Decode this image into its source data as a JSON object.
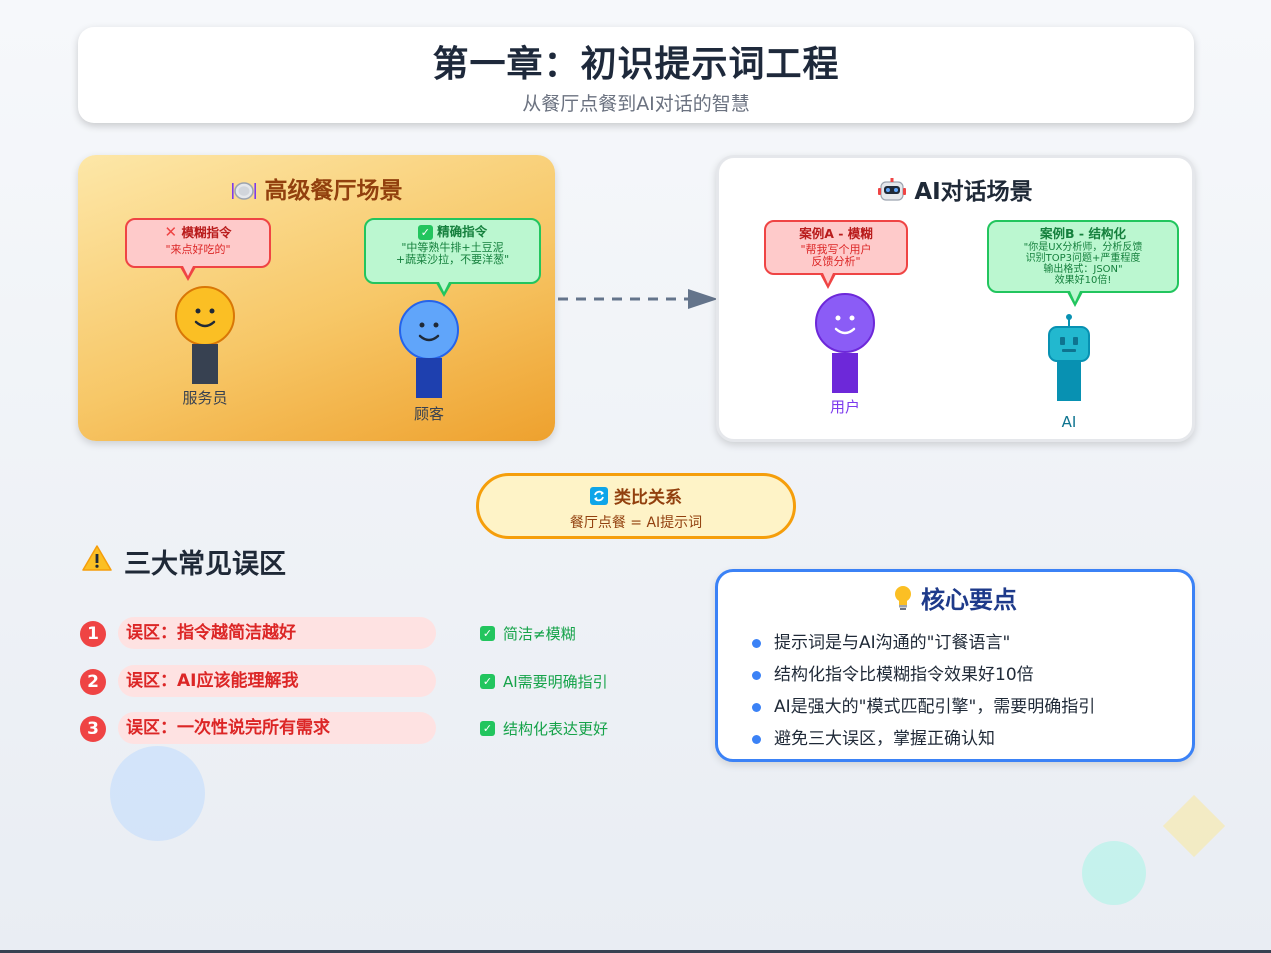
{
  "header": {
    "title": "第一章：初识提示词工程",
    "subtitle": "从餐厅点餐到AI对话的智慧"
  },
  "restaurant": {
    "icon": "plate-icon",
    "title": "高级餐厅场景",
    "vague": {
      "icon": "cross-icon",
      "title": "模糊指令",
      "text": "\"来点好吃的\""
    },
    "precise": {
      "icon": "check-icon",
      "title": "精确指令",
      "line1": "\"中等熟牛排+土豆泥",
      "line2": "+蔬菜沙拉，不要洋葱\""
    },
    "waiter_label": "服务员",
    "customer_label": "顾客"
  },
  "ai_scene": {
    "icon": "robot-icon",
    "title": "AI对话场景",
    "case_a": {
      "title": "案例A - 模糊",
      "line1": "\"帮我写个用户",
      "line2": "反馈分析\""
    },
    "case_b": {
      "title": "案例B - 结构化",
      "line1": "\"你是UX分析师，分析反馈",
      "line2": "识别TOP3问题+严重程度",
      "line3": "输出格式：JSON\"",
      "line4": "效果好10倍!"
    },
    "user_label": "用户",
    "ai_label": "AI"
  },
  "analogy": {
    "icon": "refresh-icon",
    "title": "类比关系",
    "text": "餐厅点餐 = AI提示词"
  },
  "misconceptions": {
    "icon": "warning-icon",
    "title": "三大常见误区",
    "items": [
      {
        "num": "1",
        "text": "误区：指令越简洁越好",
        "fix": "简洁≠模糊"
      },
      {
        "num": "2",
        "text": "误区：AI应该能理解我",
        "fix": "AI需要明确指引"
      },
      {
        "num": "3",
        "text": "误区：一次性说完所有需求",
        "fix": "结构化表达更好"
      }
    ]
  },
  "key_points": {
    "icon": "lightbulb-icon",
    "title": "核心要点",
    "items": [
      "提示词是与AI沟通的\"订餐语言\"",
      "结构化指令比模糊指令效果好10倍",
      "AI是强大的\"模式匹配引擎\"，需要明确指引",
      "避免三大误区，掌握正确认知"
    ]
  },
  "colors": {
    "accent_blue": "#3b82f6",
    "warning_red": "#ef4444",
    "success_green": "#22c55e",
    "restaurant_orange": "#f59e0b"
  }
}
